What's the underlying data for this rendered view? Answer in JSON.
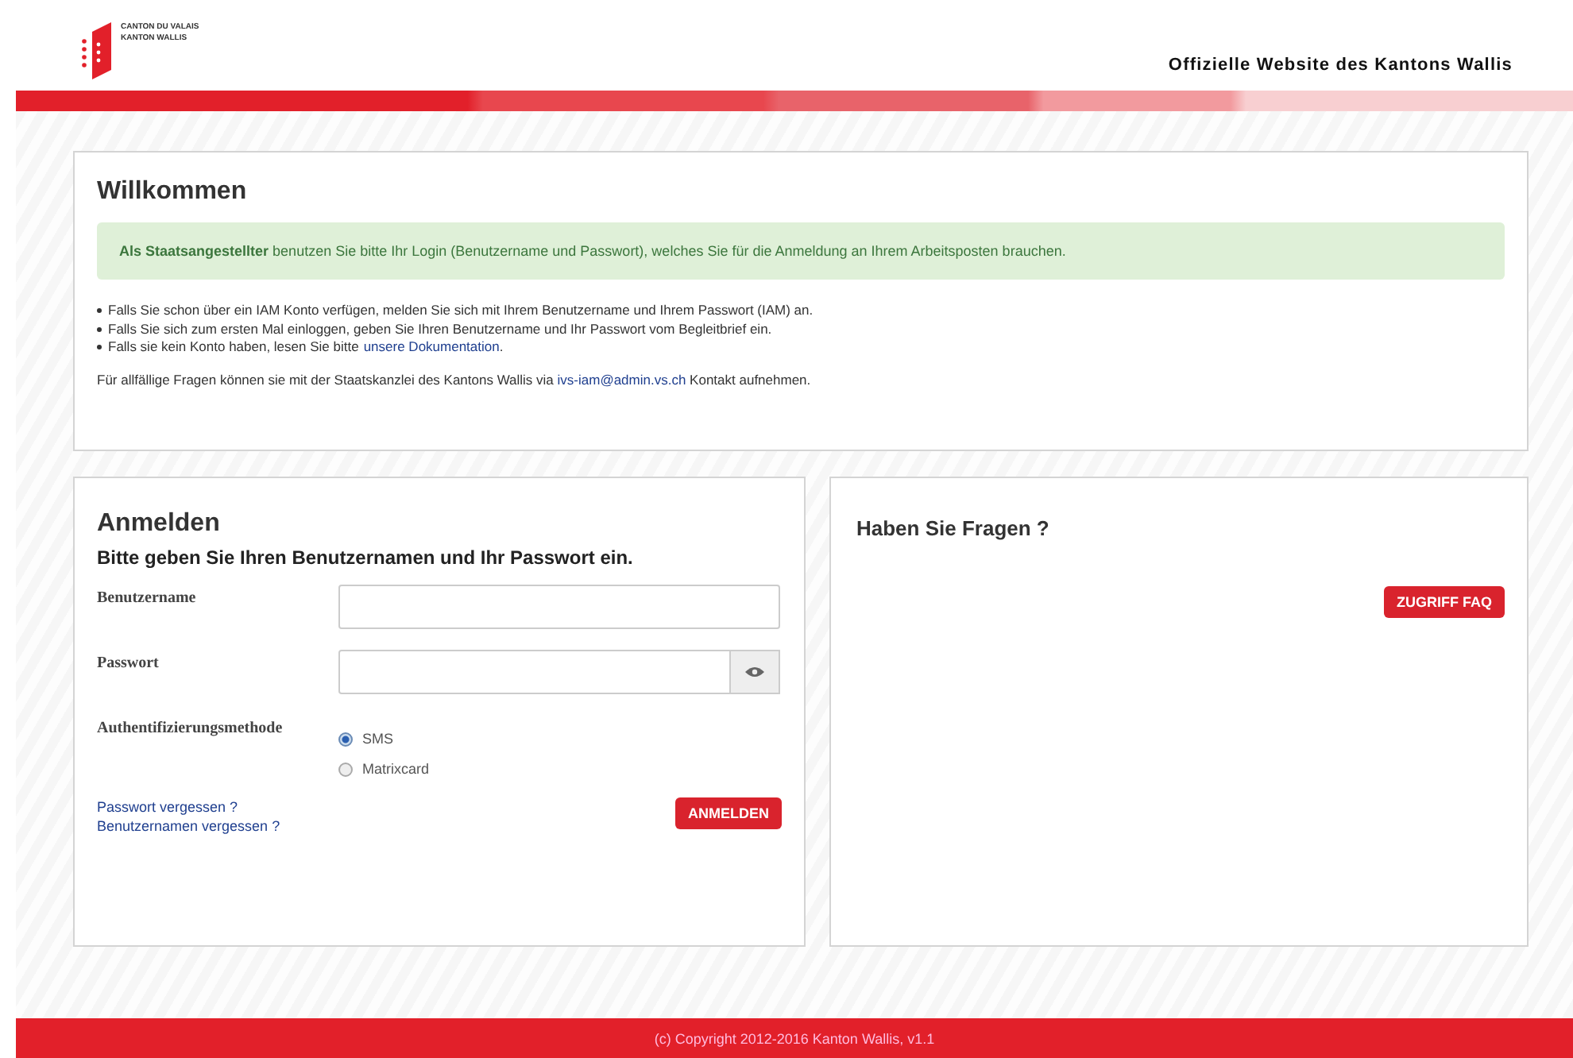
{
  "header": {
    "logo_lines": [
      "CANTON DU VALAIS",
      "KANTON WALLIS"
    ],
    "site_title": "Offizielle Website des Kantons Wallis"
  },
  "welcome": {
    "title": "Willkommen",
    "notice": "**Als Staatsangestellter** benutzen Sie bitte Ihr Login (Benutzername und Passwort), welches Sie für die Anmeldung an Ihrem Arbeitsposten brauchen.",
    "bullets": [
      {
        "text": "Falls Sie schon über ein IAM Konto verfügen, melden Sie sich mit Ihrem Benutzername und Ihrem Passwort (IAM) an."
      },
      {
        "text": "Falls Sie sich zum ersten Mal einloggen, geben Sie Ihren Benutzername und Ihr Passwort vom Begleitbrief ein."
      },
      {
        "text": "Falls sie kein Konto haben, lesen Sie bitte",
        "link": "unsere Dokumentation",
        "after": "."
      }
    ],
    "contact": {
      "text": "Für allfällige Fragen können sie mit der Staatskanzlei des Kantons Wallis via",
      "link": "ivs-iam@admin.vs.ch",
      "after": "Kontakt aufnehmen."
    }
  },
  "login": {
    "title": "Anmelden",
    "subtitle": "Bitte geben Sie Ihren Benutzernamen und Ihr Passwort ein.",
    "username_label": "Benutzername",
    "password_label": "Passwort",
    "method_label": "Authentifizierungsmethode",
    "methods": [
      {
        "label": "SMS",
        "selected": true
      },
      {
        "label": "Matrixcard",
        "selected": false
      }
    ],
    "links": [
      "Passwort vergessen ?",
      "Benutzernamen vergessen ?"
    ],
    "submit": "ANMELDEN"
  },
  "faq": {
    "title": "Haben Sie Fragen ?",
    "button": "ZUGRIFF FAQ"
  },
  "footer": "(c) Copyright 2012-2016 Kanton Wallis, v1.1"
}
